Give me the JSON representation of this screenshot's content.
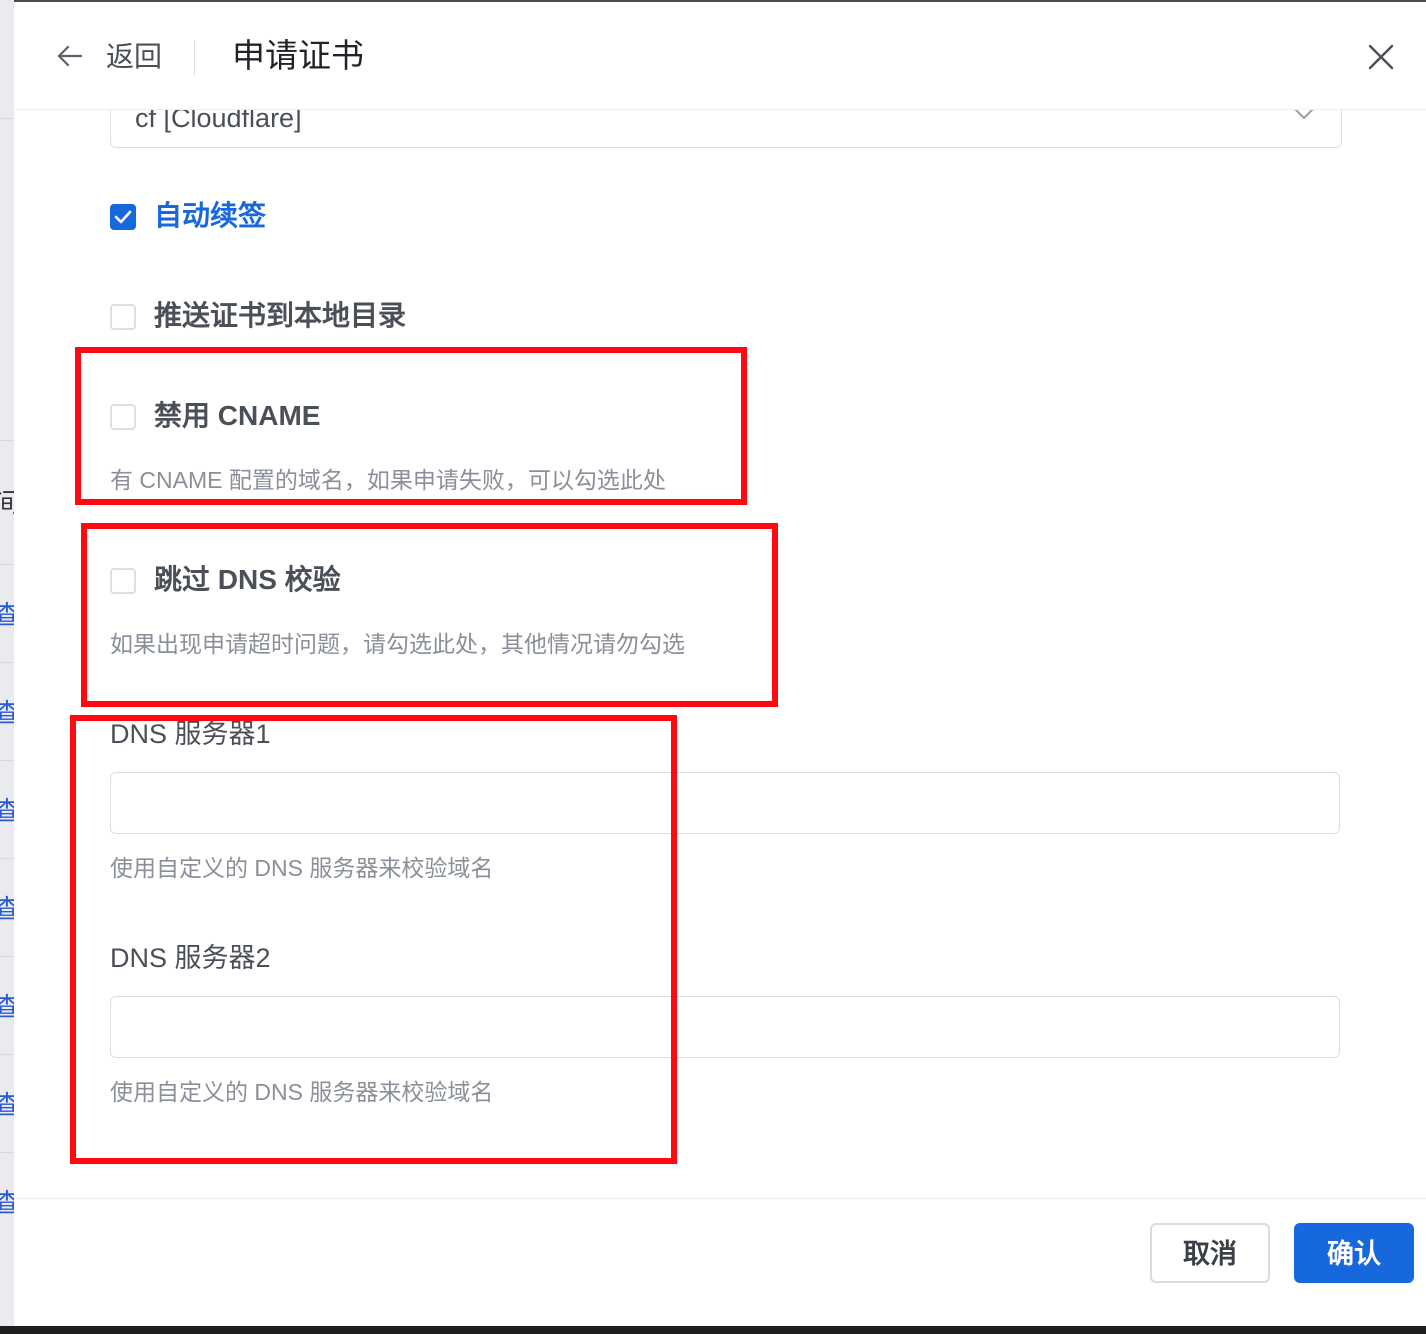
{
  "background": {
    "fragments": [
      "查",
      "查",
      "查",
      "查",
      "查",
      "查",
      "查"
    ],
    "partial_label": "间"
  },
  "header": {
    "back_label": "返回",
    "title": "申请证书"
  },
  "form": {
    "select_value": "cf [Cloudflare]",
    "auto_renew_label": "自动续签",
    "auto_renew_checked": true,
    "push_local_label": "推送证书到本地目录",
    "disable_cname_label": "禁用 CNAME",
    "disable_cname_help": "有 CNAME 配置的域名，如果申请失败，可以勾选此处",
    "skip_dns_label": "跳过 DNS 校验",
    "skip_dns_help": "如果出现申请超时问题，请勾选此处，其他情况请勿勾选",
    "dns1_label": "DNS 服务器1",
    "dns1_value": "",
    "dns1_help": "使用自定义的 DNS 服务器来校验域名",
    "dns2_label": "DNS 服务器2",
    "dns2_value": "",
    "dns2_help": "使用自定义的 DNS 服务器来校验域名"
  },
  "footer": {
    "cancel_label": "取消",
    "ok_label": "确认"
  },
  "colors": {
    "primary": "#1668dc",
    "annotation": "#ff0a12"
  }
}
